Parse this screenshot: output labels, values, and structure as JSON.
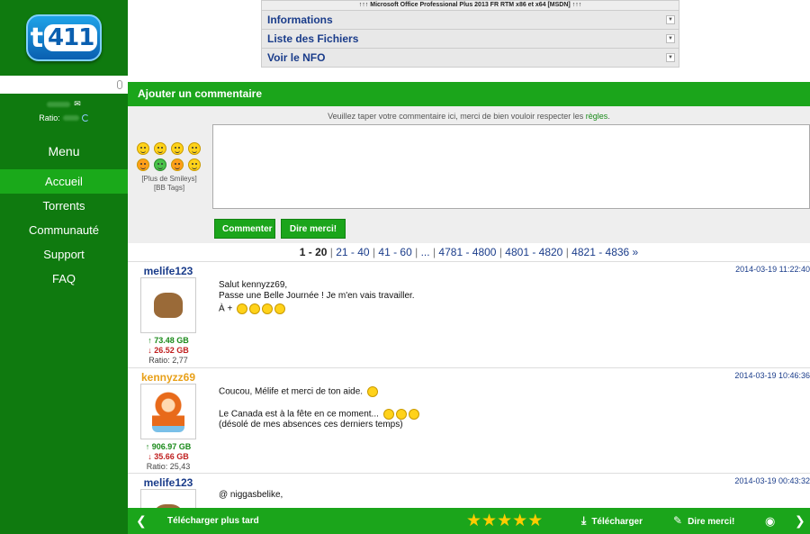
{
  "sidebar": {
    "logo_text": "t411",
    "ratio_label": "Ratio:",
    "menu_title": "Menu",
    "nav": [
      "Accueil",
      "Torrents",
      "Communauté",
      "Support",
      "FAQ"
    ]
  },
  "torrent": {
    "title_strip": "↑↑↑ Microsoft Office Professional Plus 2013 FR RTM x86 et x64 [MSDN] ↑↑↑",
    "sections": [
      "Informations",
      "Liste des Fichiers",
      "Voir le NFO"
    ]
  },
  "comment_form": {
    "header": "Ajouter un commentaire",
    "hint_before": "Veuillez taper votre commentaire ici, merci de bien vouloir respecter les",
    "hint_link": "règles",
    "hint_after": ".",
    "more_smileys": "[Plus de Smileys]",
    "bb_tags": "[BB Tags]",
    "submit_label": "Commenter",
    "thanks_label": "Dire merci!"
  },
  "pagination": {
    "current": "1 - 20",
    "pages": [
      "21 - 40",
      "41 - 60",
      "...",
      "4781 - 4800",
      "4801 - 4820",
      "4821 - 4836 »"
    ]
  },
  "comments": [
    {
      "user": "melife123",
      "date": "2014-03-19 11:22:40",
      "up": "↑ 73.48 GB",
      "down": "↓ 26.52 GB",
      "ratio": "Ratio: 2,77",
      "lines": [
        "Salut kennyzz69,",
        "Passe une Belle Journée ! Je m'en vais travailler.",
        "À +"
      ]
    },
    {
      "user": "kennyzz69",
      "date": "2014-03-19 10:46:36",
      "up": "↑ 906.97 GB",
      "down": "↓ 35.66 GB",
      "ratio": "Ratio: 25,43",
      "lines": [
        "Coucou, Mélife et merci de ton aide.",
        "Le Canada est à la fête en ce moment...",
        "(désolé de mes absences ces derniers temps)"
      ]
    },
    {
      "user": "melife123",
      "date": "2014-03-19 00:43:32",
      "lines": [
        "@ niggasbelike,"
      ]
    }
  ],
  "bottom_bar": {
    "download_later": "Télécharger plus tard",
    "rating_stars": 5,
    "download": "Télécharger",
    "say_thanks": "Dire merci!"
  }
}
